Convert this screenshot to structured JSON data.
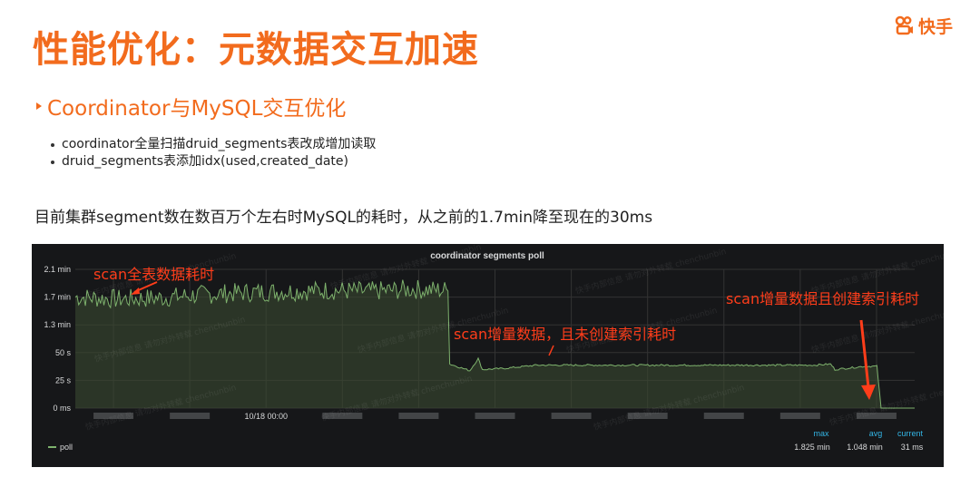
{
  "brand": {
    "name": "快手"
  },
  "slide": {
    "title": "性能优化：元数据交互加速",
    "subheading": "Coordinator与MySQL交互优化",
    "bullets": [
      "coordinator全量扫描druid_segments表改成增加读取",
      "druid_segments表添加idx(used,created_date)"
    ],
    "summary": "目前集群segment数在数百万个左右时MySQL的耗时，从之前的1.7min降至现在的30ms"
  },
  "chart_data": {
    "type": "line",
    "title": "coordinator segments poll",
    "y_ticks": [
      "2.1 min",
      "1.7 min",
      "1.3 min",
      "50 s",
      "25 s",
      "0 ms"
    ],
    "ylim_ms": [
      0,
      126000
    ],
    "x_labels": [
      "",
      "",
      "10/18 00:00",
      "",
      "",
      "",
      "",
      "",
      "",
      "",
      ""
    ],
    "series": [
      {
        "name": "poll",
        "color": "#7eb26d",
        "points": [
          {
            "x": 0.0,
            "y": 101000
          },
          {
            "x": 0.05,
            "y": 99000
          },
          {
            "x": 0.1,
            "y": 100000
          },
          {
            "x": 0.15,
            "y": 103000
          },
          {
            "x": 0.2,
            "y": 105000
          },
          {
            "x": 0.25,
            "y": 106000
          },
          {
            "x": 0.3,
            "y": 107000
          },
          {
            "x": 0.35,
            "y": 106000
          },
          {
            "x": 0.4,
            "y": 108000
          },
          {
            "x": 0.444,
            "y": 107000
          },
          {
            "x": 0.446,
            "y": 40000
          },
          {
            "x": 0.47,
            "y": 34000
          },
          {
            "x": 0.48,
            "y": 45000
          },
          {
            "x": 0.485,
            "y": 35000
          },
          {
            "x": 0.51,
            "y": 36000
          },
          {
            "x": 0.55,
            "y": 39000
          },
          {
            "x": 0.6,
            "y": 39000
          },
          {
            "x": 0.7,
            "y": 39000
          },
          {
            "x": 0.8,
            "y": 39000
          },
          {
            "x": 0.88,
            "y": 39000
          },
          {
            "x": 0.9,
            "y": 40000
          },
          {
            "x": 0.905,
            "y": 35000
          },
          {
            "x": 0.94,
            "y": 38000
          },
          {
            "x": 0.955,
            "y": 38000
          },
          {
            "x": 0.96,
            "y": 31
          },
          {
            "x": 1.0,
            "y": 31
          }
        ]
      }
    ],
    "legend": {
      "placement": "bottom-left",
      "label": "poll"
    },
    "stats": {
      "headers": [
        "max",
        "avg",
        "current"
      ],
      "values": [
        "1.825 min",
        "1.048 min",
        "31 ms"
      ]
    },
    "annotations": [
      "scan全表数据耗时",
      "scan增量数据，且未创建索引耗时",
      "scan增量数据且创建索引耗时"
    ],
    "watermark": "快手内部信息 请勿对外转载 chenchunbin",
    "colors": {
      "background": "#161719",
      "grid": "#333333",
      "line": "#7eb26d",
      "fill": "#3b4a30",
      "annotation": "#ff3d1a",
      "stats_header": "#33b5e5",
      "tick_text": "#d8d9da"
    }
  }
}
